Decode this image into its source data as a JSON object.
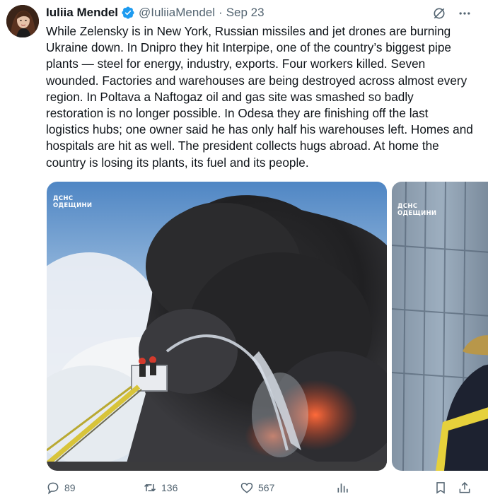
{
  "tweet": {
    "author_name": "Iuliia Mendel",
    "handle": "@IuliiaMendel",
    "separator": "·",
    "date": "Sep 23",
    "text": "While Zelensky is in New York, Russian missiles and jet drones are burning Ukraine down. In Dnipro they hit Interpipe, one of the country’s biggest pipe plants — steel for energy, industry, exports. Four workers killed. Seven wounded. Factories and warehouses are being destroyed across almost every region. In Poltava a Naftogaz oil and gas site was smashed so badly restoration is no longer possible. In Odesa they are finishing off the last logistics hubs; one owner said he has only half his warehouses left. Homes and hospitals are hit as well. The president collects hugs abroad. At home the country is losing its plants, its fuel and its people."
  },
  "media": {
    "photo_1_watermark_line1": "ДСНС",
    "photo_1_watermark_line2": "ОДЕЩИНИ",
    "photo_2_watermark_line1": "ДСНС",
    "photo_2_watermark_line2": "ОДЕЩИНИ"
  },
  "actions": {
    "reply_count": "89",
    "repost_count": "136",
    "like_count": "567"
  },
  "icons": {
    "verified": "verified-badge-icon",
    "grok": "grok-icon",
    "more": "more-icon",
    "reply": "reply-icon",
    "repost": "repost-icon",
    "like": "heart-icon",
    "views": "views-icon",
    "bookmark": "bookmark-icon",
    "share": "share-icon"
  },
  "colors": {
    "text": "#0f1419",
    "secondary": "#536471",
    "verified": "#1d9bf0"
  }
}
